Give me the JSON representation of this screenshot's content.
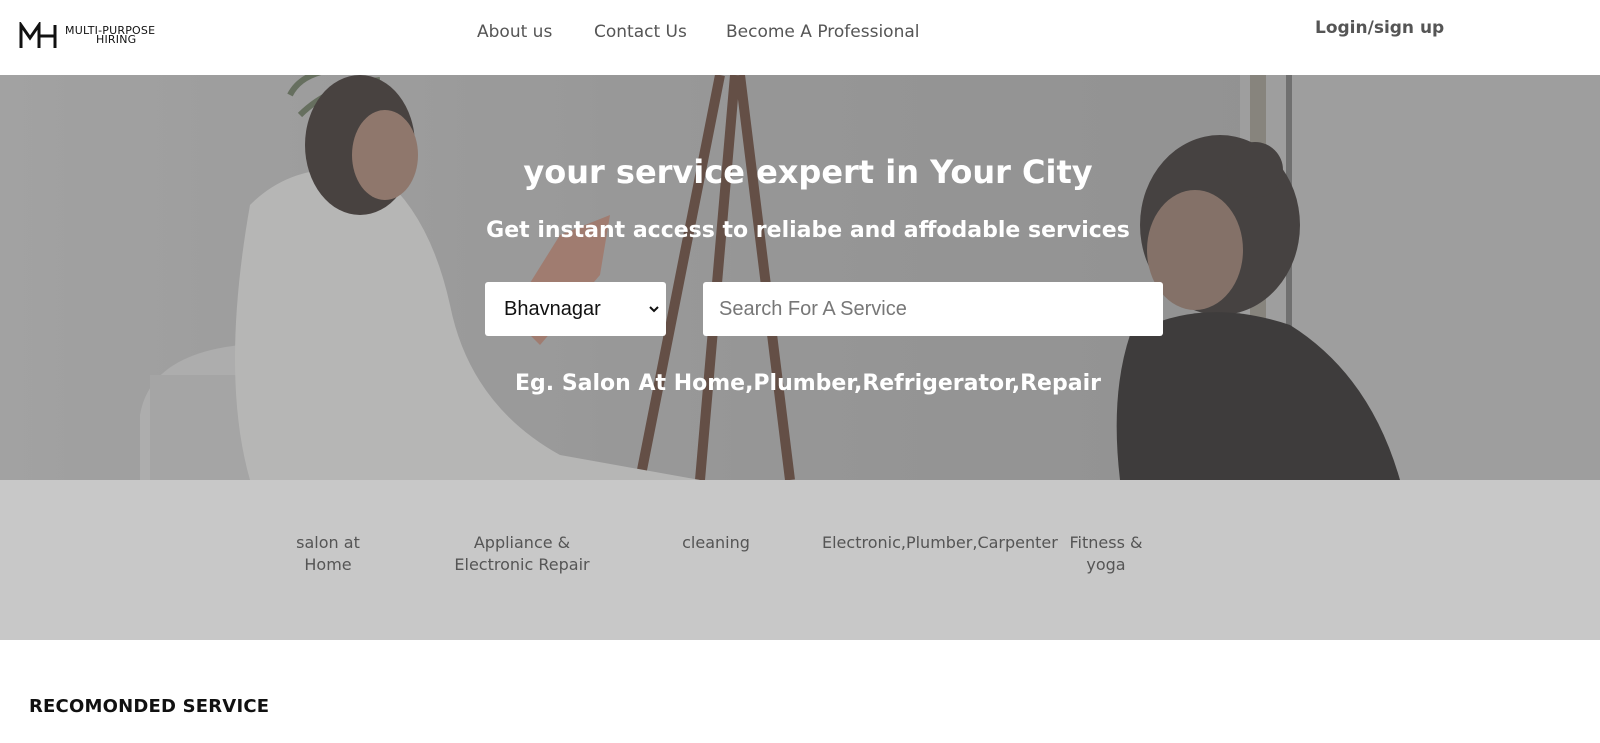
{
  "header": {
    "logo_line1": "MULTI-PURPOSE",
    "logo_line2": "HIRING",
    "nav": [
      "About us",
      "Contact Us",
      "Become A Professional"
    ],
    "login": "Login/sign up"
  },
  "hero": {
    "title": "your service expert in Your City",
    "subtitle": "Get instant access to reliabe and affodable services",
    "city_selected": "Bhavnagar",
    "search_placeholder": "Search For A Service",
    "example": "Eg. Salon At Home,Plumber,Refrigerator,Repair"
  },
  "categories": [
    "salon at Home",
    "Appliance & Electronic Repair",
    "cleaning",
    "Electronic,Plumber,Carpenter",
    "Fitness & yoga"
  ],
  "section_title": "RECOMONDED SERVICE",
  "icons": {
    "logo": "mh-logo-icon",
    "select": "chevron-down-icon"
  },
  "colors": {
    "header_bg": "#ffffff",
    "category_bar": "#c8c8c8",
    "nav_text": "#555555",
    "hero_text": "#ffffff"
  }
}
